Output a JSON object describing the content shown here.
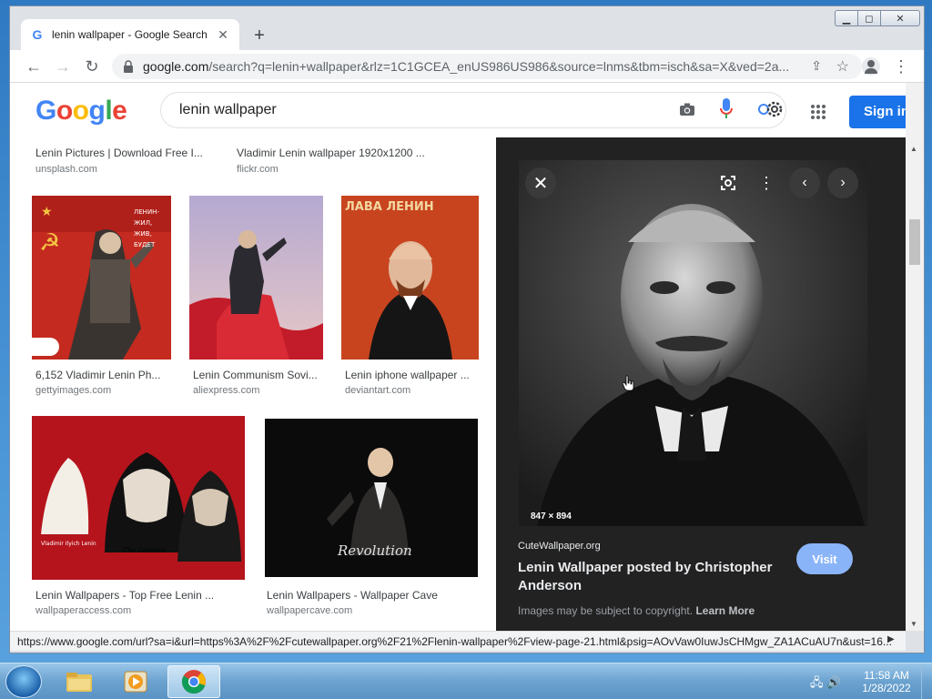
{
  "browser": {
    "tab_title": "lenin wallpaper - Google Search",
    "tab_close": "✕",
    "new_tab": "+",
    "url_host": "google.com",
    "url_rest": "/search?q=lenin+wallpaper&rlz=1C1GCEA_enUS986US986&source=lnms&tbm=isch&sa=X&ved=2a...",
    "status_url": "https://www.google.com/url?sa=i&url=https%3A%2F%2Fcutewallpaper.org%2F21%2Flenin-wallpaper%2Fview-page-21.html&psig=AOvVaw0IuwJsCHMgw_ZA1ACuAU7n&ust=16..."
  },
  "google": {
    "search_query": "lenin wallpaper",
    "signin_label": "Sign in",
    "logo_colors": [
      "#4285f4",
      "#ea4335",
      "#fbbc05",
      "#4285f4",
      "#34a853",
      "#ea4335"
    ]
  },
  "results": {
    "top_row": [
      {
        "title": "Lenin Pictures | Download Free I...",
        "source": "unsplash.com"
      },
      {
        "title": "Vladimir Lenin wallpaper 1920x1200 ...",
        "source": "flickr.com"
      }
    ],
    "row1": [
      {
        "title": "6,152 Vladimir Lenin Ph...",
        "source": "gettyimages.com"
      },
      {
        "title": "Lenin Communism Sovi...",
        "source": "aliexpress.com"
      },
      {
        "title": "Lenin iphone wallpaper ...",
        "source": "deviantart.com"
      }
    ],
    "row2": [
      {
        "title": "Lenin Wallpapers - Top Free Lenin ...",
        "source": "wallpaperaccess.com"
      },
      {
        "title": "Lenin Wallpapers - Wallpaper Cave",
        "source": "wallpapercave.com"
      }
    ]
  },
  "preview": {
    "dimensions": "847 × 894",
    "source": "CuteWallpaper.org",
    "title": "Lenin Wallpaper posted by Christopher Anderson",
    "visit_label": "Visit",
    "copyright": "Images may be subject to copyright.",
    "learn_more": "Learn More"
  },
  "taskbar": {
    "time": "11:58 AM",
    "date": "1/28/2022"
  }
}
